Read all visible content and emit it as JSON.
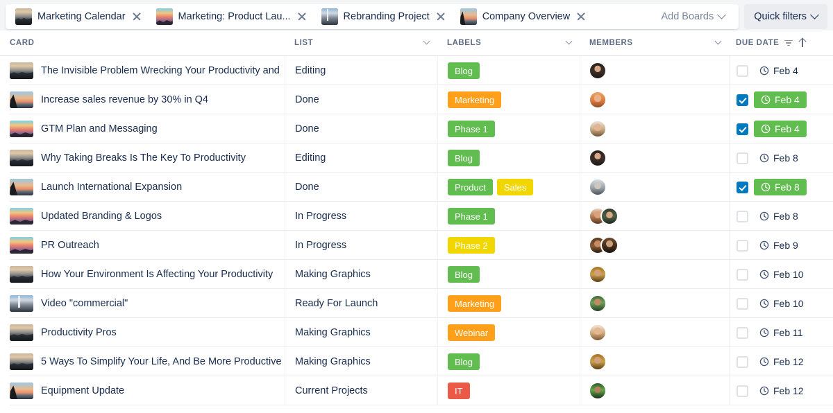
{
  "topbar": {
    "tabs": [
      {
        "label": "Marketing Calendar",
        "thumb": "sunset-a",
        "close_icon": "close-icon"
      },
      {
        "label": "Marketing: Product Lau...",
        "thumb": "sunset-c",
        "close_icon": "close-icon"
      },
      {
        "label": "Rebranding Project",
        "thumb": "night-d",
        "close_icon": "close-icon"
      },
      {
        "label": "Company Overview",
        "thumb": "sunset-b",
        "close_icon": "close-icon"
      }
    ],
    "add_boards_label": "Add Boards",
    "quick_filters_label": "Quick filters"
  },
  "table": {
    "columns": [
      {
        "key": "card",
        "label": "CARD",
        "has_chevron": false
      },
      {
        "key": "list",
        "label": "LIST",
        "has_chevron": true
      },
      {
        "key": "labels",
        "label": "LABELS",
        "has_chevron": true
      },
      {
        "key": "members",
        "label": "MEMBERS",
        "has_chevron": true
      },
      {
        "key": "due",
        "label": "DUE DATE",
        "has_chevron": false,
        "filter_icon": "filter-icon",
        "sort_icon": "sort-ascending-icon"
      }
    ],
    "rows": [
      {
        "title": "The Invisible Problem Wrecking Your Productivity and",
        "thumb": "sunset-a",
        "list": "Editing",
        "labels": [
          {
            "text": "Blog",
            "color": "#61bd4f"
          }
        ],
        "members": [
          "f1"
        ],
        "checked": false,
        "due": "Feb 4",
        "due_complete": false
      },
      {
        "title": "Increase sales revenue by 30% in Q4",
        "thumb": "sunset-b",
        "list": "Done",
        "labels": [
          {
            "text": "Marketing",
            "color": "#ff9f1a"
          }
        ],
        "members": [
          "f2"
        ],
        "checked": true,
        "due": "Feb 4",
        "due_complete": true
      },
      {
        "title": "GTM Plan and Messaging",
        "thumb": "sunset-c",
        "list": "Done",
        "labels": [
          {
            "text": "Phase 1",
            "color": "#61bd4f"
          }
        ],
        "members": [
          "f3"
        ],
        "checked": true,
        "due": "Feb 4",
        "due_complete": true
      },
      {
        "title": "Why Taking Breaks Is The Key To Productivity",
        "thumb": "sunset-a",
        "list": "Editing",
        "labels": [
          {
            "text": "Blog",
            "color": "#61bd4f"
          }
        ],
        "members": [
          "f1"
        ],
        "checked": false,
        "due": "Feb 8",
        "due_complete": false
      },
      {
        "title": "Launch International Expansion",
        "thumb": "sunset-b",
        "list": "Done",
        "labels": [
          {
            "text": "Product",
            "color": "#61bd4f"
          },
          {
            "text": "Sales",
            "color": "#f2d600"
          }
        ],
        "members": [
          "f4"
        ],
        "checked": true,
        "due": "Feb 8",
        "due_complete": true
      },
      {
        "title": "Updated Branding & Logos",
        "thumb": "sunset-c",
        "list": "In Progress",
        "labels": [
          {
            "text": "Phase 1",
            "color": "#61bd4f"
          }
        ],
        "members": [
          "f5",
          "f6"
        ],
        "checked": false,
        "due": "Feb 8",
        "due_complete": false
      },
      {
        "title": "PR Outreach",
        "thumb": "sunset-c",
        "list": "In Progress",
        "labels": [
          {
            "text": "Phase 2",
            "color": "#f2d600"
          }
        ],
        "members": [
          "f7",
          "f8"
        ],
        "checked": false,
        "due": "Feb 9",
        "due_complete": false
      },
      {
        "title": "How Your Environment Is Affecting Your Productivity",
        "thumb": "sunset-a",
        "list": "Making Graphics",
        "labels": [
          {
            "text": "Blog",
            "color": "#61bd4f"
          }
        ],
        "members": [
          "f11"
        ],
        "checked": false,
        "due": "Feb 10",
        "due_complete": false
      },
      {
        "title": "Video \"commercial\"",
        "thumb": "night-d",
        "list": "Ready For Launch",
        "labels": [
          {
            "text": "Marketing",
            "color": "#ff9f1a"
          }
        ],
        "members": [
          "f9"
        ],
        "checked": false,
        "due": "Feb 10",
        "due_complete": false
      },
      {
        "title": "Productivity Pros",
        "thumb": "sunset-a",
        "list": "Making Graphics",
        "labels": [
          {
            "text": "Webinar",
            "color": "#ff9f1a"
          }
        ],
        "members": [
          "f10"
        ],
        "checked": false,
        "due": "Feb 11",
        "due_complete": false
      },
      {
        "title": "5 Ways To Simplify Your Life, And Be More Productive",
        "thumb": "sunset-a",
        "list": "Making Graphics",
        "labels": [
          {
            "text": "Blog",
            "color": "#61bd4f"
          }
        ],
        "members": [
          "f11"
        ],
        "checked": false,
        "due": "Feb 12",
        "due_complete": false
      },
      {
        "title": "Equipment Update",
        "thumb": "sunset-b",
        "list": "Current Projects",
        "labels": [
          {
            "text": "IT",
            "color": "#eb5a46"
          }
        ],
        "members": [
          "f12"
        ],
        "checked": false,
        "due": "Feb 12",
        "due_complete": false
      }
    ]
  },
  "colors": {
    "green": "#61bd4f",
    "orange": "#ff9f1a",
    "yellow": "#f2d600",
    "red": "#eb5a46",
    "checkbox_blue": "#0079bf"
  }
}
